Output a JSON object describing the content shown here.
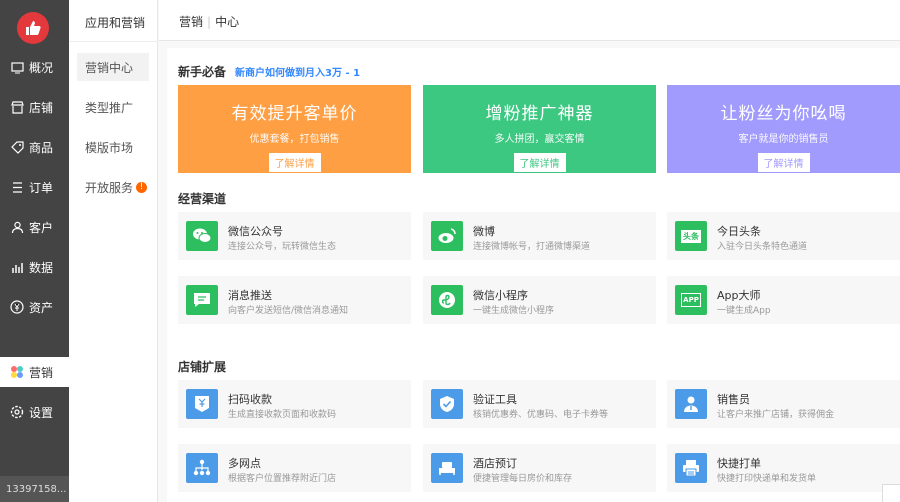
{
  "nav": {
    "items": [
      {
        "label": "概况",
        "icon": "dashboard-icon"
      },
      {
        "label": "店铺",
        "icon": "store-icon"
      },
      {
        "label": "商品",
        "icon": "tag-icon"
      },
      {
        "label": "订单",
        "icon": "order-list-icon"
      },
      {
        "label": "客户",
        "icon": "user-icon"
      },
      {
        "label": "数据",
        "icon": "bar-chart-icon"
      },
      {
        "label": "资产",
        "icon": "money-icon"
      },
      {
        "label": "营销",
        "icon": "marketing-flower-icon"
      },
      {
        "label": "设置",
        "icon": "gear-icon"
      }
    ],
    "user": "13397158..."
  },
  "subnav": {
    "title": "应用和营销",
    "items": [
      {
        "label": "营销中心"
      },
      {
        "label": "类型推广"
      },
      {
        "label": "模版市场"
      },
      {
        "label": "开放服务",
        "badge": "!"
      }
    ]
  },
  "header": {
    "crumb1": "营销",
    "crumb2": "中心"
  },
  "newbie": {
    "title": "新手必备",
    "link": "新商户如何做到月入3万 - 1",
    "banners": [
      {
        "title": "有效提升客单价",
        "sub": "优惠套餐，打包销售",
        "btn": "了解详情",
        "color": "#ff9f43"
      },
      {
        "title": "增粉推广神器",
        "sub": "多人拼团，赢交客情",
        "btn": "了解详情",
        "color": "#3cc881"
      },
      {
        "title": "让粉丝为你吆喝",
        "sub": "客户就是你的销售员",
        "btn": "了解详情",
        "color": "#a29bfe"
      }
    ]
  },
  "channels": {
    "title": "经营渠道",
    "cards": [
      {
        "title": "微信公众号",
        "desc": "连接公众号，玩转微信生态",
        "icon": "wechat-icon"
      },
      {
        "title": "微博",
        "desc": "连接微博帐号，打通微博渠道",
        "icon": "weibo-icon"
      },
      {
        "title": "今日头条",
        "desc": "入驻今日头条特色通道",
        "icon": "toutiao-icon",
        "iconText": "头条"
      },
      {
        "title": "消息推送",
        "desc": "向客户发送短信/微信消息通知",
        "icon": "message-icon"
      },
      {
        "title": "微信小程序",
        "desc": "一键生成微信小程序",
        "icon": "mini-program-icon"
      },
      {
        "title": "App大师",
        "desc": "一键生成App",
        "icon": "app-icon",
        "iconText": "APP"
      }
    ]
  },
  "expand": {
    "title": "店铺扩展",
    "cards": [
      {
        "title": "扫码收款",
        "desc": "生成直接收款页面和收款码",
        "icon": "qr-payment-icon"
      },
      {
        "title": "验证工具",
        "desc": "核销优惠券、优惠码、电子卡券等",
        "icon": "shield-check-icon"
      },
      {
        "title": "销售员",
        "desc": "让客户来推广店铺，获得佣金",
        "icon": "salesperson-icon"
      },
      {
        "title": "多网点",
        "desc": "根据客户位置推荐附近门店",
        "icon": "network-icon"
      },
      {
        "title": "酒店预订",
        "desc": "便捷管理每日房价和库存",
        "icon": "hotel-bed-icon"
      },
      {
        "title": "快捷打单",
        "desc": "快捷打印快递单和发货单",
        "icon": "printer-icon"
      }
    ]
  }
}
